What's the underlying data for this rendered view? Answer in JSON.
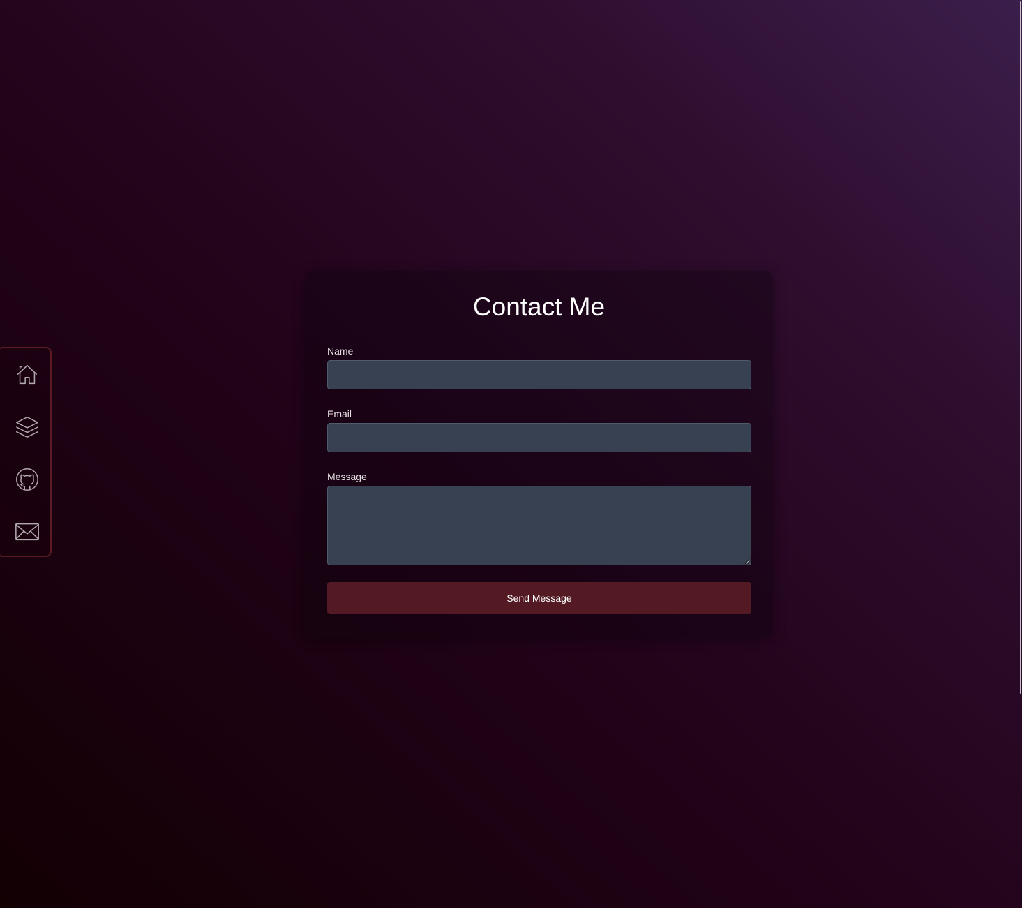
{
  "nav": {
    "items": [
      {
        "icon": "home-icon"
      },
      {
        "icon": "layers-icon"
      },
      {
        "icon": "github-icon"
      },
      {
        "icon": "mail-icon"
      }
    ],
    "border_color": "#5c1b24",
    "icon_color": "#b3aab0"
  },
  "contact": {
    "title": "Contact Me",
    "name_label": "Name",
    "name_value": "",
    "email_label": "Email",
    "email_value": "",
    "message_label": "Message",
    "message_value": "",
    "send_label": "Send Message"
  },
  "colors": {
    "input_bg": "#374151",
    "button_bg": "#541a24",
    "background_dark": "#120003",
    "background_light": "#3b1e4b"
  }
}
